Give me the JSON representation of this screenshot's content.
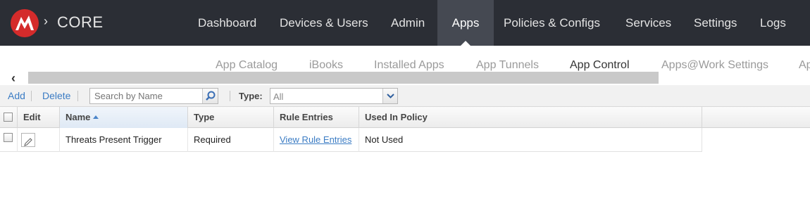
{
  "header": {
    "brand": "CORE",
    "breadcrumb_sep": "›",
    "nav": [
      {
        "label": "Dashboard"
      },
      {
        "label": "Devices & Users"
      },
      {
        "label": "Admin"
      },
      {
        "label": "Apps",
        "active": true
      },
      {
        "label": "Policies & Configs"
      },
      {
        "label": "Services"
      },
      {
        "label": "Settings"
      },
      {
        "label": "Logs"
      }
    ]
  },
  "subnav": {
    "tabs": [
      {
        "label": "App Catalog"
      },
      {
        "label": "iBooks"
      },
      {
        "label": "Installed Apps"
      },
      {
        "label": "App Tunnels"
      },
      {
        "label": "App Control",
        "active": true
      },
      {
        "label": "Apps@Work Settings"
      },
      {
        "label": "Ap"
      }
    ],
    "scroll_left": "‹"
  },
  "toolbar": {
    "add_label": "Add",
    "delete_label": "Delete",
    "search_placeholder": "Search by Name",
    "type_label": "Type:",
    "type_value": "All"
  },
  "grid": {
    "columns": [
      "Edit",
      "Name",
      "Type",
      "Rule Entries",
      "Used In Policy"
    ],
    "rows": [
      {
        "name": "Threats Present Trigger",
        "type": "Required",
        "rule_entries": "View Rule Entries",
        "used_in_policy": "Not Used"
      }
    ]
  },
  "colors": {
    "topbar": "#2b2e35",
    "active_tab": "#454952",
    "logo": "#d42b2b",
    "link": "#3b7cc4"
  }
}
